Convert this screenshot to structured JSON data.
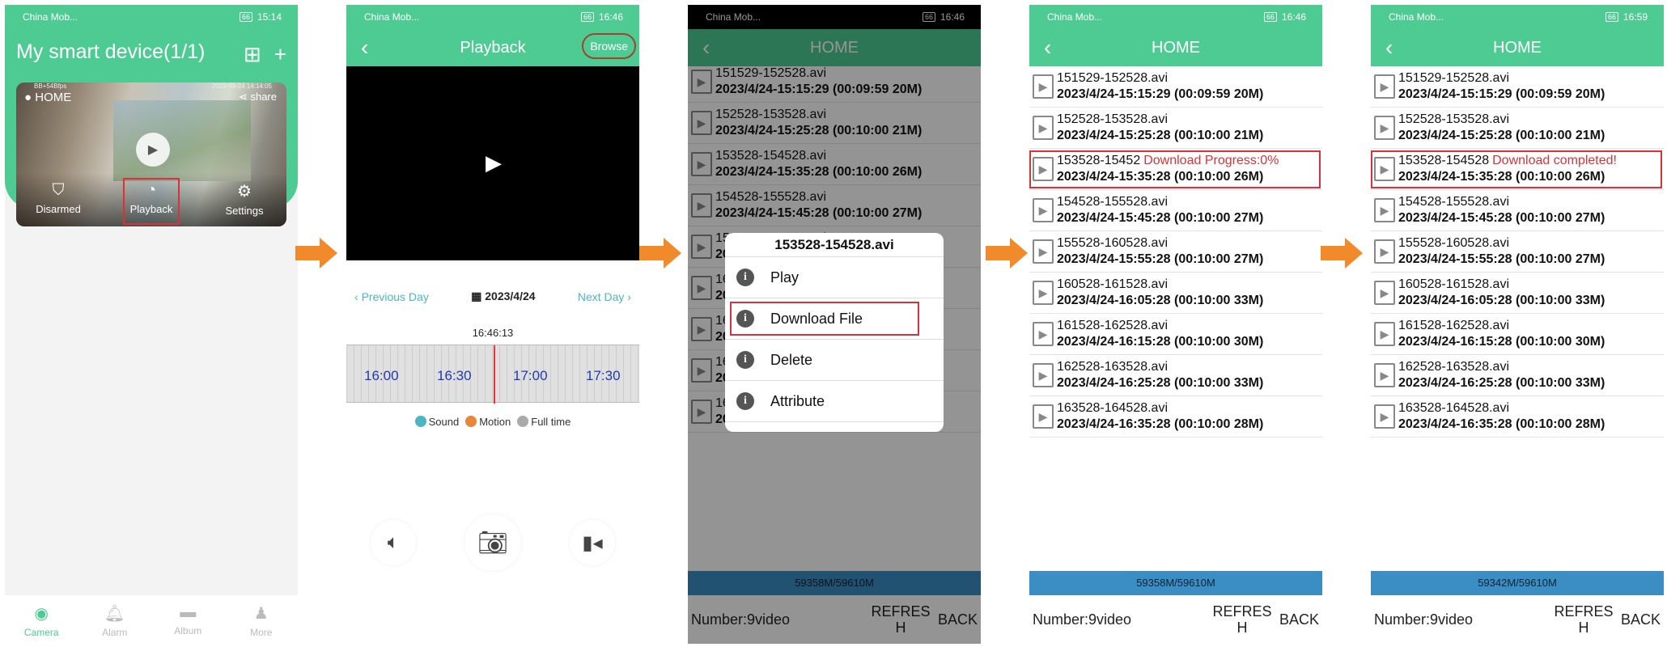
{
  "status": {
    "carrier": "China Mob...",
    "time1": "15:14",
    "time2": "16:46",
    "time5": "16:59",
    "battery": "66"
  },
  "p1": {
    "title": "My smart device(1/1)",
    "cam_name": "HOME",
    "share": "share",
    "ts_left": "BB+54Bfps",
    "ts_right": "2023-04-24 14:14:05",
    "btn_disarmed": "Disarmed",
    "btn_playback": "Playback",
    "btn_settings": "Settings",
    "tabs": [
      "Camera",
      "Alarm",
      "Album",
      "More"
    ]
  },
  "p2": {
    "title": "Playback",
    "browse": "Browse",
    "prev": "Previous Day",
    "date": "2023/4/24",
    "next": "Next Day",
    "time": "16:46:13",
    "ticks": [
      "16:00",
      "16:30",
      "17:00",
      "17:30"
    ],
    "legend": [
      "Sound",
      "Motion",
      "Full time"
    ]
  },
  "home_title": "HOME",
  "files": [
    {
      "name": "151529-152528.avi",
      "info": "2023/4/24-15:15:29  (00:09:59  20M)"
    },
    {
      "name": "152528-153528.avi",
      "info": "2023/4/24-15:25:28  (00:10:00  21M)"
    },
    {
      "name": "153528-154528.avi",
      "info": "2023/4/24-15:35:28  (00:10:00  26M)"
    },
    {
      "name": "154528-155528.avi",
      "info": "2023/4/24-15:45:28  (00:10:00  27M)"
    },
    {
      "name": "155528-160528.avi",
      "info": "2023/4/24-15:55:28  (00:10:00  27M)"
    },
    {
      "name": "160528-161528.avi",
      "info": "2023/4/24-16:05:28  (00:10:00  33M)"
    },
    {
      "name": "161528-162528.avi",
      "info": "2023/4/24-16:15:28  (00:10:00  30M)"
    },
    {
      "name": "162528-163528.avi",
      "info": "2023/4/24-16:25:28  (00:10:00  33M)"
    },
    {
      "name": "163528-164528.avi",
      "info": "2023/4/24-16:35:28  (00:10:00  28M)"
    }
  ],
  "p4_name3": "153528-15452",
  "p4_status": "Download Progress:0%",
  "p5_name3": "153528-154528",
  "p5_status": "Download completed!",
  "dialog": {
    "title": "153528-154528.avi",
    "items": [
      "Play",
      "Download File",
      "Delete",
      "Attribute"
    ]
  },
  "storage1": "59358M/59610M",
  "storage2": "59342M/59610M",
  "footer": {
    "number": "Number:9video",
    "refresh_a": "REFRES",
    "refresh_b": "H",
    "back": "BACK"
  },
  "colors": {
    "accent": "#4ecb93",
    "highlight": "#d6333b",
    "storage_bar": "#3a8ec3",
    "arrow": "#f08a2a"
  }
}
